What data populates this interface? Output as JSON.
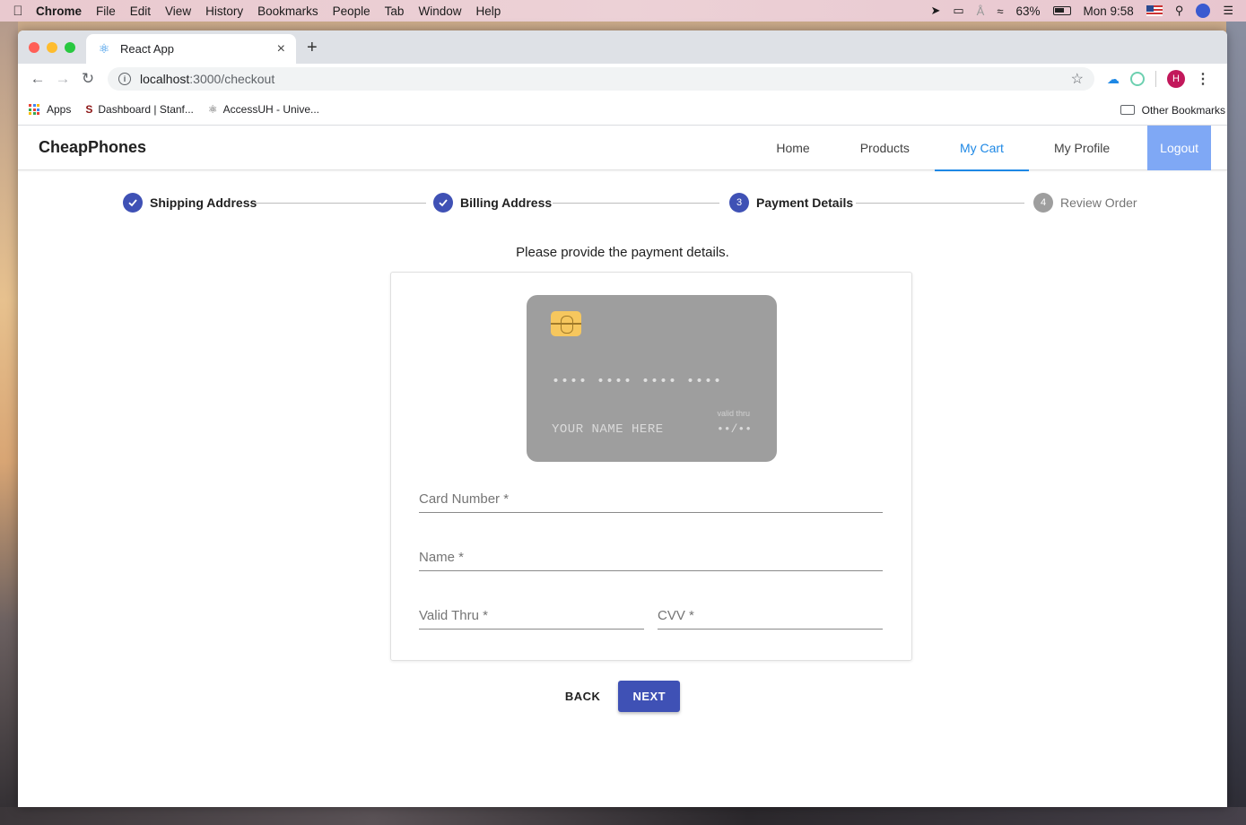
{
  "menubar": {
    "app": "Chrome",
    "items": [
      "File",
      "Edit",
      "View",
      "History",
      "Bookmarks",
      "People",
      "Tab",
      "Window",
      "Help"
    ],
    "battery": "63%",
    "clock": "Mon 9:58"
  },
  "browser": {
    "tab_title": "React App",
    "url_host": "localhost",
    "url_path": ":3000/checkout",
    "bookmarks": [
      {
        "label": "Apps",
        "icon": "apps-grid-icon"
      },
      {
        "label": "Dashboard | Stanf...",
        "icon": "stanford-icon"
      },
      {
        "label": "AccessUH - Unive...",
        "icon": "uh-icon"
      }
    ],
    "other_bookmarks": "Other Bookmarks",
    "profile_initial": "H"
  },
  "app": {
    "brand": "CheapPhones",
    "nav": [
      {
        "label": "Home",
        "active": false
      },
      {
        "label": "Products",
        "active": false
      },
      {
        "label": "My Cart",
        "active": true
      },
      {
        "label": "My Profile",
        "active": false
      }
    ],
    "logout": "Logout"
  },
  "stepper": {
    "steps": [
      {
        "label": "Shipping Address",
        "status": "done",
        "number": "1"
      },
      {
        "label": "Billing Address",
        "status": "done",
        "number": "2"
      },
      {
        "label": "Payment Details",
        "status": "active",
        "number": "3"
      },
      {
        "label": "Review Order",
        "status": "pending",
        "number": "4"
      }
    ]
  },
  "payment": {
    "instructions": "Please provide the payment details.",
    "card": {
      "number": "•••• •••• •••• ••••",
      "name": "YOUR NAME HERE",
      "valid_label": "valid thru",
      "expiry": "••/••"
    },
    "fields": {
      "card_number": "Card Number *",
      "name": "Name *",
      "valid_thru": "Valid Thru *",
      "cvv": "CVV *"
    }
  },
  "actions": {
    "back": "BACK",
    "next": "NEXT"
  },
  "colors": {
    "primary": "#3f51b5",
    "nav_active": "#1e88e5",
    "logout_bg": "#7fa8f5",
    "card_bg": "#9e9e9e",
    "chip": "#f6c75e"
  }
}
